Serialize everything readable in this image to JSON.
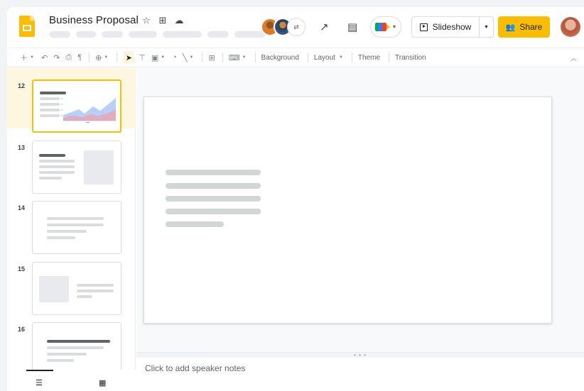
{
  "header": {
    "title": "Business Proposal",
    "title_icons": [
      "star-icon",
      "move-to-folder-icon",
      "cloud-saved-icon"
    ],
    "slideshow_label": "Slideshow",
    "share_label": "Share",
    "share_icon": "people-icon"
  },
  "toolbar": {
    "background_label": "Background",
    "layout_label": "Layout",
    "theme_label": "Theme",
    "transition_label": "Transition"
  },
  "filmstrip": {
    "slides": [
      {
        "number": "12",
        "selected": true
      },
      {
        "number": "13",
        "selected": false
      },
      {
        "number": "14",
        "selected": false
      },
      {
        "number": "15",
        "selected": false
      },
      {
        "number": "16",
        "selected": false
      }
    ]
  },
  "notes": {
    "placeholder": "Click to add speaker notes"
  },
  "colors": {
    "accent": "#fbbc04",
    "selected_bg": "#fef7e0",
    "chart_series_1": "#aecbfa",
    "chart_series_2": "#e6a8b8"
  }
}
